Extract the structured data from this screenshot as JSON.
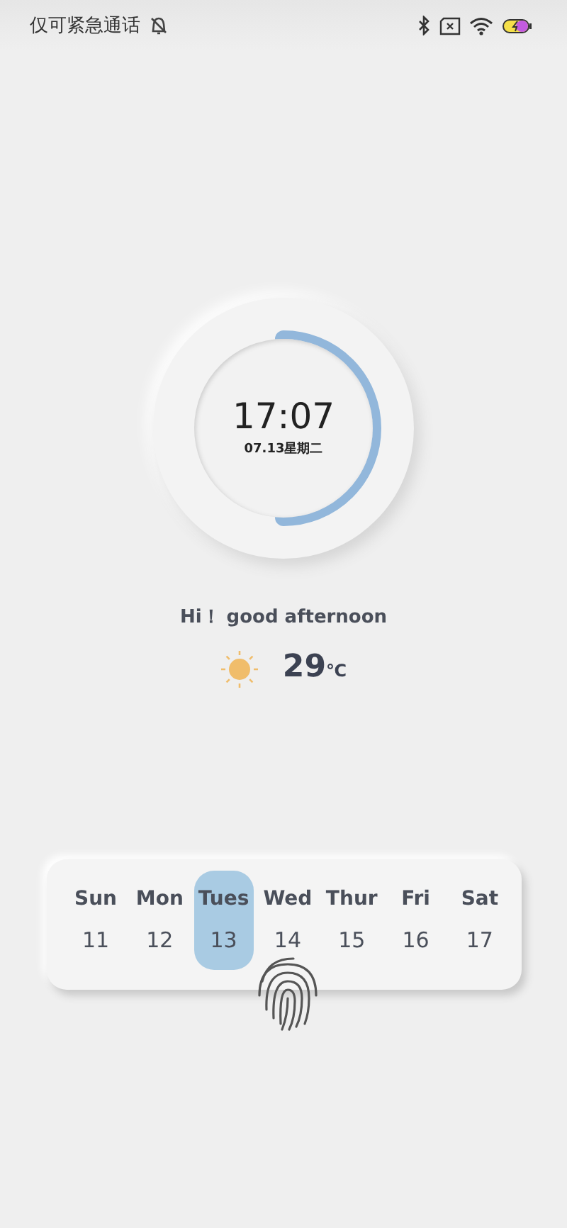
{
  "status_bar": {
    "carrier": "仅可紧急通话"
  },
  "clock": {
    "time": "17:07",
    "date": "07.13星期二"
  },
  "greeting": "Hi！ good afternoon",
  "weather": {
    "temperature": "29",
    "unit": "℃"
  },
  "week": [
    {
      "day": "Sun",
      "date": "11",
      "selected": false
    },
    {
      "day": "Mon",
      "date": "12",
      "selected": false
    },
    {
      "day": "Tues",
      "date": "13",
      "selected": true
    },
    {
      "day": "Wed",
      "date": "14",
      "selected": false
    },
    {
      "day": "Thur",
      "date": "15",
      "selected": false
    },
    {
      "day": "Fri",
      "date": "16",
      "selected": false
    },
    {
      "day": "Sat",
      "date": "17",
      "selected": false
    }
  ]
}
